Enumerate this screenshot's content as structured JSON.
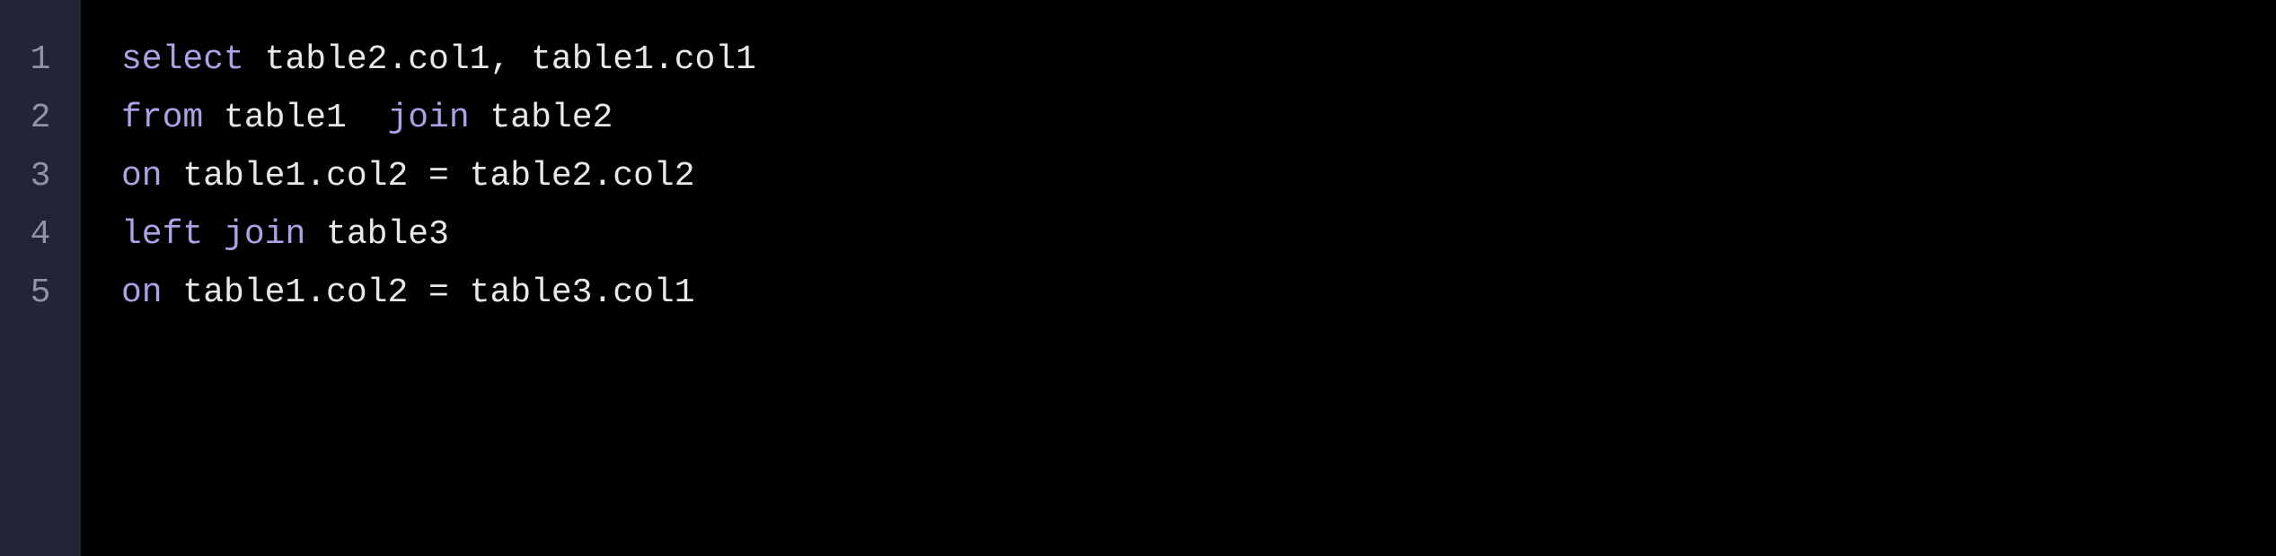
{
  "editor": {
    "lines": [
      {
        "number": "1",
        "tokens": [
          {
            "type": "keyword",
            "text": "select"
          },
          {
            "type": "identifier",
            "text": " table2.col1, table1.col1"
          }
        ]
      },
      {
        "number": "2",
        "tokens": [
          {
            "type": "keyword",
            "text": "from"
          },
          {
            "type": "identifier",
            "text": " table1  "
          },
          {
            "type": "keyword",
            "text": "join"
          },
          {
            "type": "identifier",
            "text": " table2"
          }
        ]
      },
      {
        "number": "3",
        "tokens": [
          {
            "type": "keyword",
            "text": "on"
          },
          {
            "type": "identifier",
            "text": " table1.col2 = table2.col2"
          }
        ]
      },
      {
        "number": "4",
        "tokens": [
          {
            "type": "keyword",
            "text": "left"
          },
          {
            "type": "identifier",
            "text": " "
          },
          {
            "type": "keyword",
            "text": "join"
          },
          {
            "type": "identifier",
            "text": " table3"
          }
        ]
      },
      {
        "number": "5",
        "tokens": [
          {
            "type": "keyword",
            "text": "on"
          },
          {
            "type": "identifier",
            "text": " table1.col2 = table3.col1"
          }
        ]
      }
    ]
  }
}
